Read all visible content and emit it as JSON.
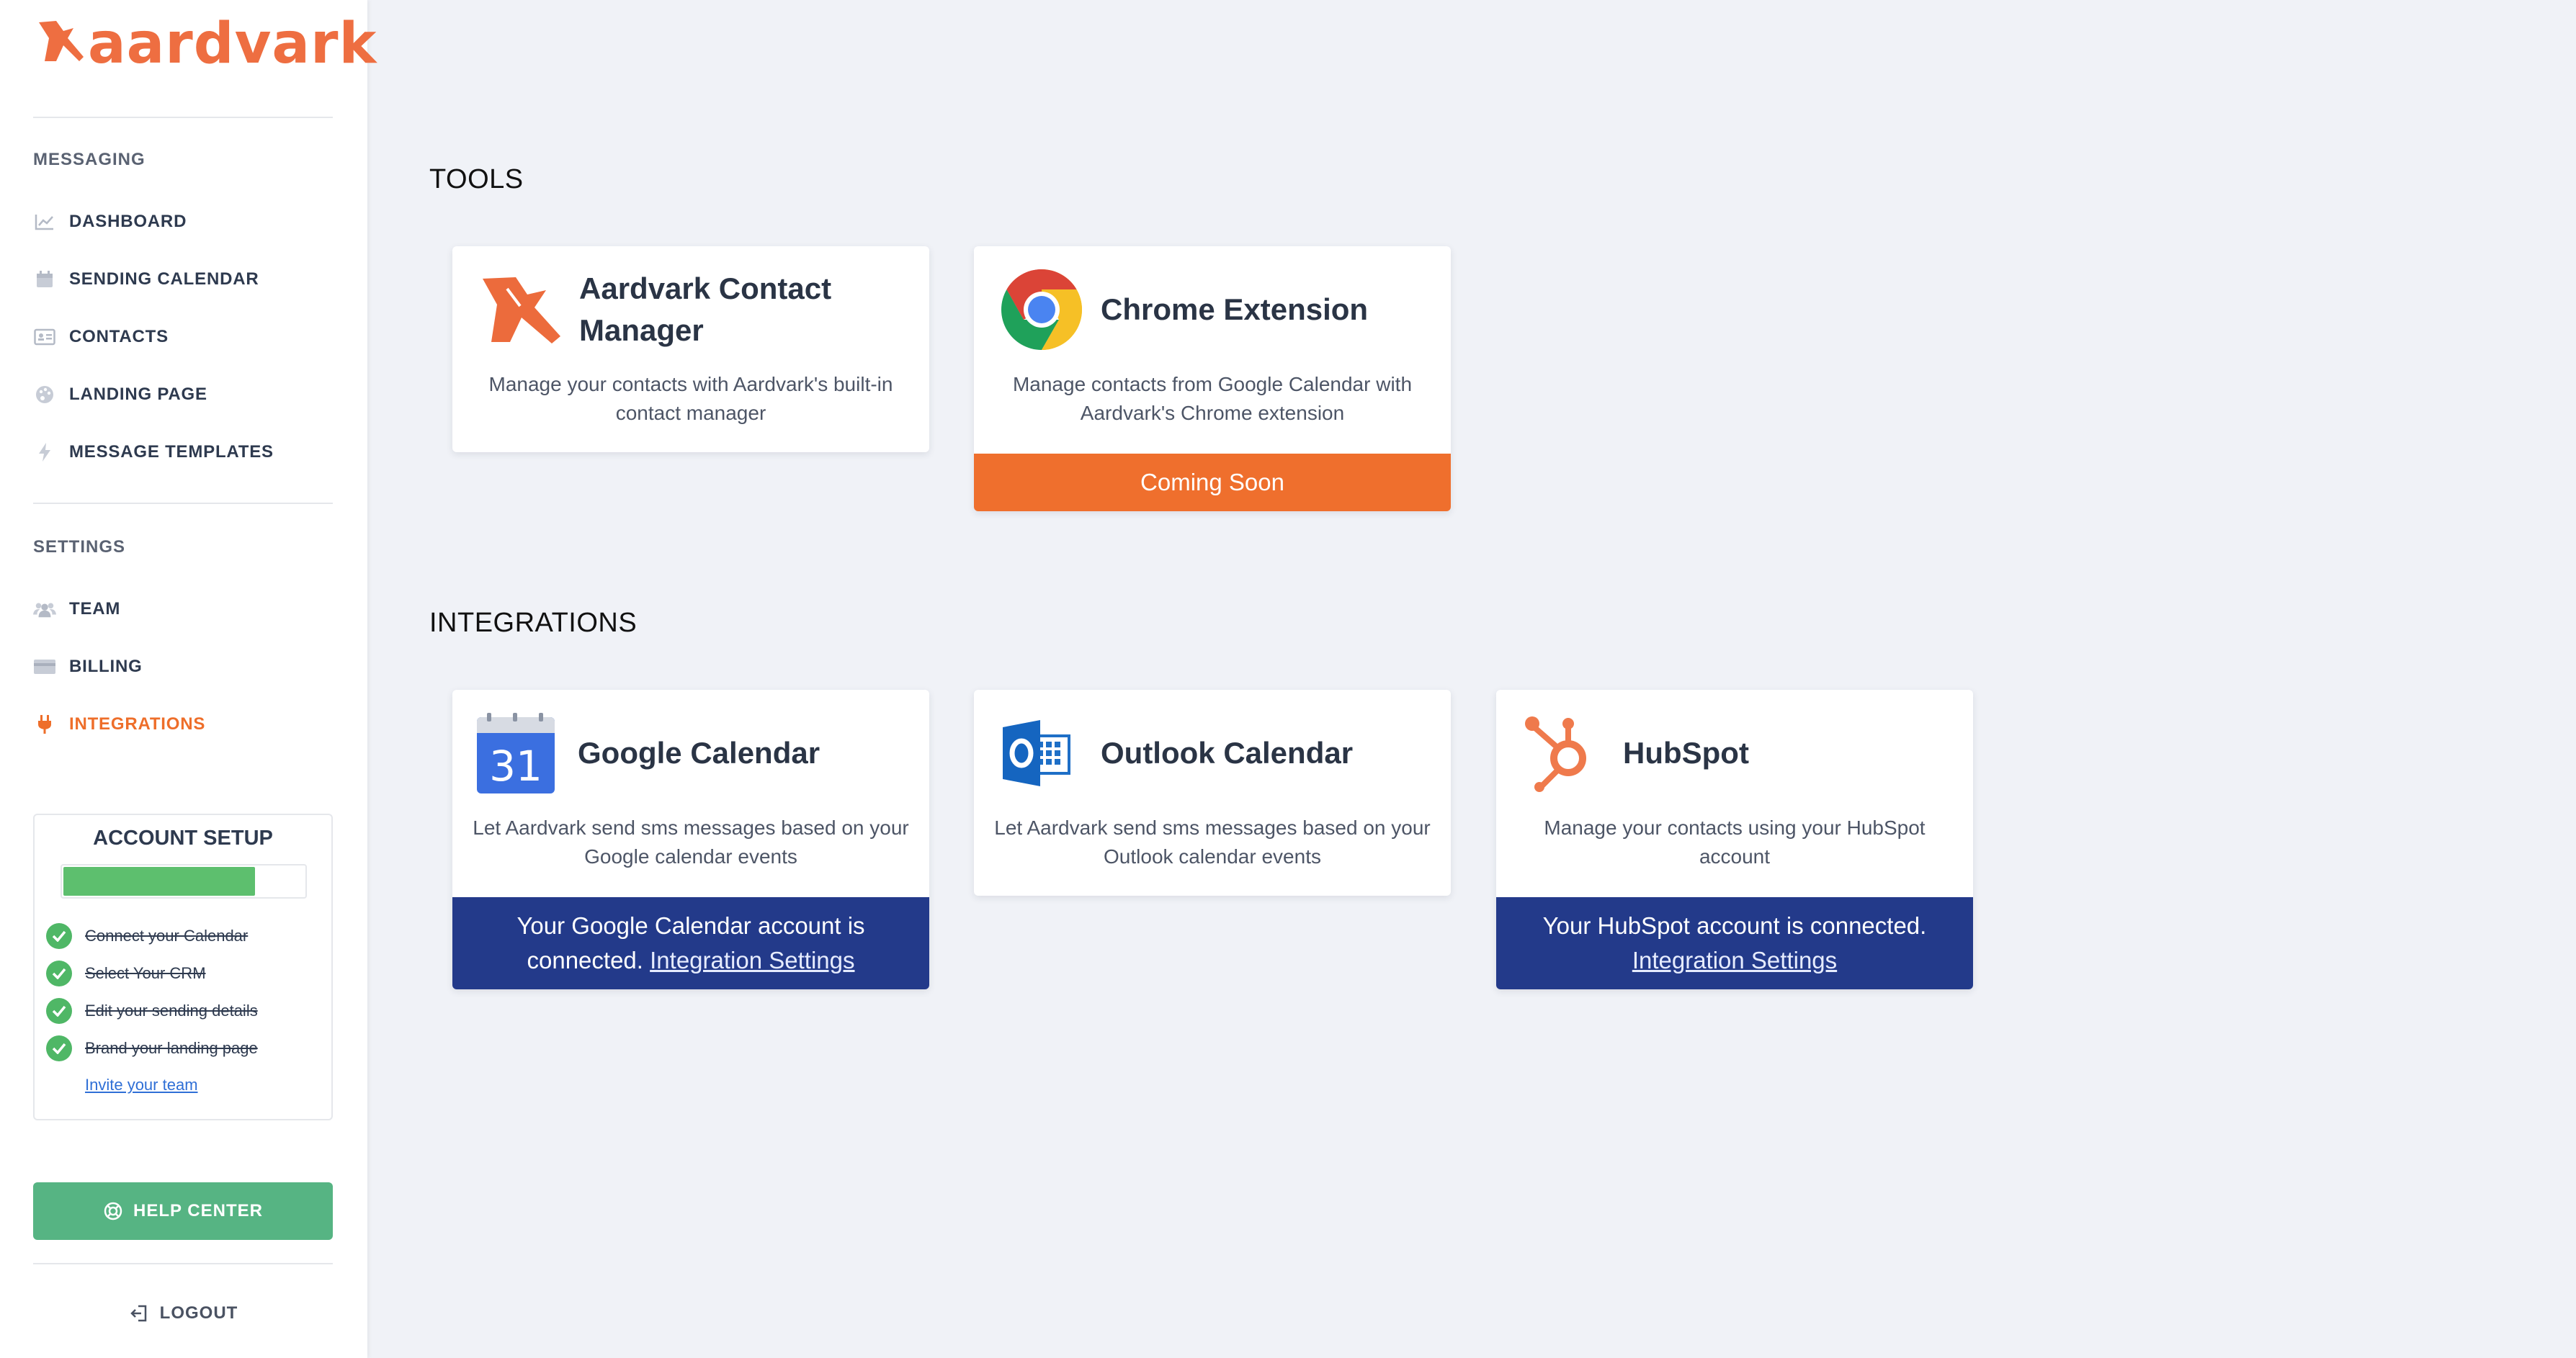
{
  "brand": {
    "name": "aardvark",
    "color": "#ee6e41"
  },
  "sidebar": {
    "messaging_title": "MESSAGING",
    "messaging_items": [
      {
        "label": "DASHBOARD",
        "icon": "chart-line-icon"
      },
      {
        "label": "SENDING CALENDAR",
        "icon": "calendar-icon"
      },
      {
        "label": "CONTACTS",
        "icon": "id-card-icon"
      },
      {
        "label": "LANDING PAGE",
        "icon": "palette-icon"
      },
      {
        "label": "MESSAGE TEMPLATES",
        "icon": "bolt-icon"
      }
    ],
    "settings_title": "SETTINGS",
    "settings_items": [
      {
        "label": "TEAM",
        "icon": "users-icon"
      },
      {
        "label": "BILLING",
        "icon": "credit-card-icon"
      },
      {
        "label": "INTEGRATIONS",
        "icon": "plug-icon",
        "active": true
      }
    ],
    "account_setup": {
      "title": "ACCOUNT SETUP",
      "progress": 0.8,
      "steps": [
        {
          "label": "Connect your Calendar",
          "done": true
        },
        {
          "label": "Select Your CRM",
          "done": true
        },
        {
          "label": "Edit your sending details",
          "done": true
        },
        {
          "label": "Brand your landing page",
          "done": true
        }
      ],
      "invite_link": "Invite your team"
    },
    "help_center": "HELP CENTER",
    "logout": "LOGOUT"
  },
  "main": {
    "tools_heading": "TOOLS",
    "tools": [
      {
        "title": "Aardvark Contact Manager",
        "description": "Manage your contacts with Aardvark's built-in contact manager",
        "icon": "aardvark-logo-icon"
      },
      {
        "title": "Chrome Extension",
        "description": "Manage contacts from Google Calendar with Aardvark's Chrome extension",
        "icon": "chrome-icon",
        "bar": "Coming Soon"
      }
    ],
    "integrations_heading": "INTEGRATIONS",
    "integrations": [
      {
        "title": "Google Calendar",
        "description": "Let Aardvark send sms messages based on your Google calendar events",
        "icon": "google-calendar-icon",
        "calendar_day": "31",
        "status": "Your Google Calendar account is connected.",
        "link": "Integration Settings"
      },
      {
        "title": "Outlook Calendar",
        "description": "Let Aardvark send sms messages based on your Outlook calendar events",
        "icon": "outlook-icon"
      },
      {
        "title": "HubSpot",
        "description": "Manage your contacts using your HubSpot account",
        "icon": "hubspot-icon",
        "status": "Your HubSpot account is connected.",
        "link": "Integration Settings"
      }
    ]
  },
  "colors": {
    "accent_orange": "#ef6f2d",
    "connected_blue": "#233a8a",
    "help_green": "#56b483",
    "progress_green": "#5dbf6e"
  }
}
